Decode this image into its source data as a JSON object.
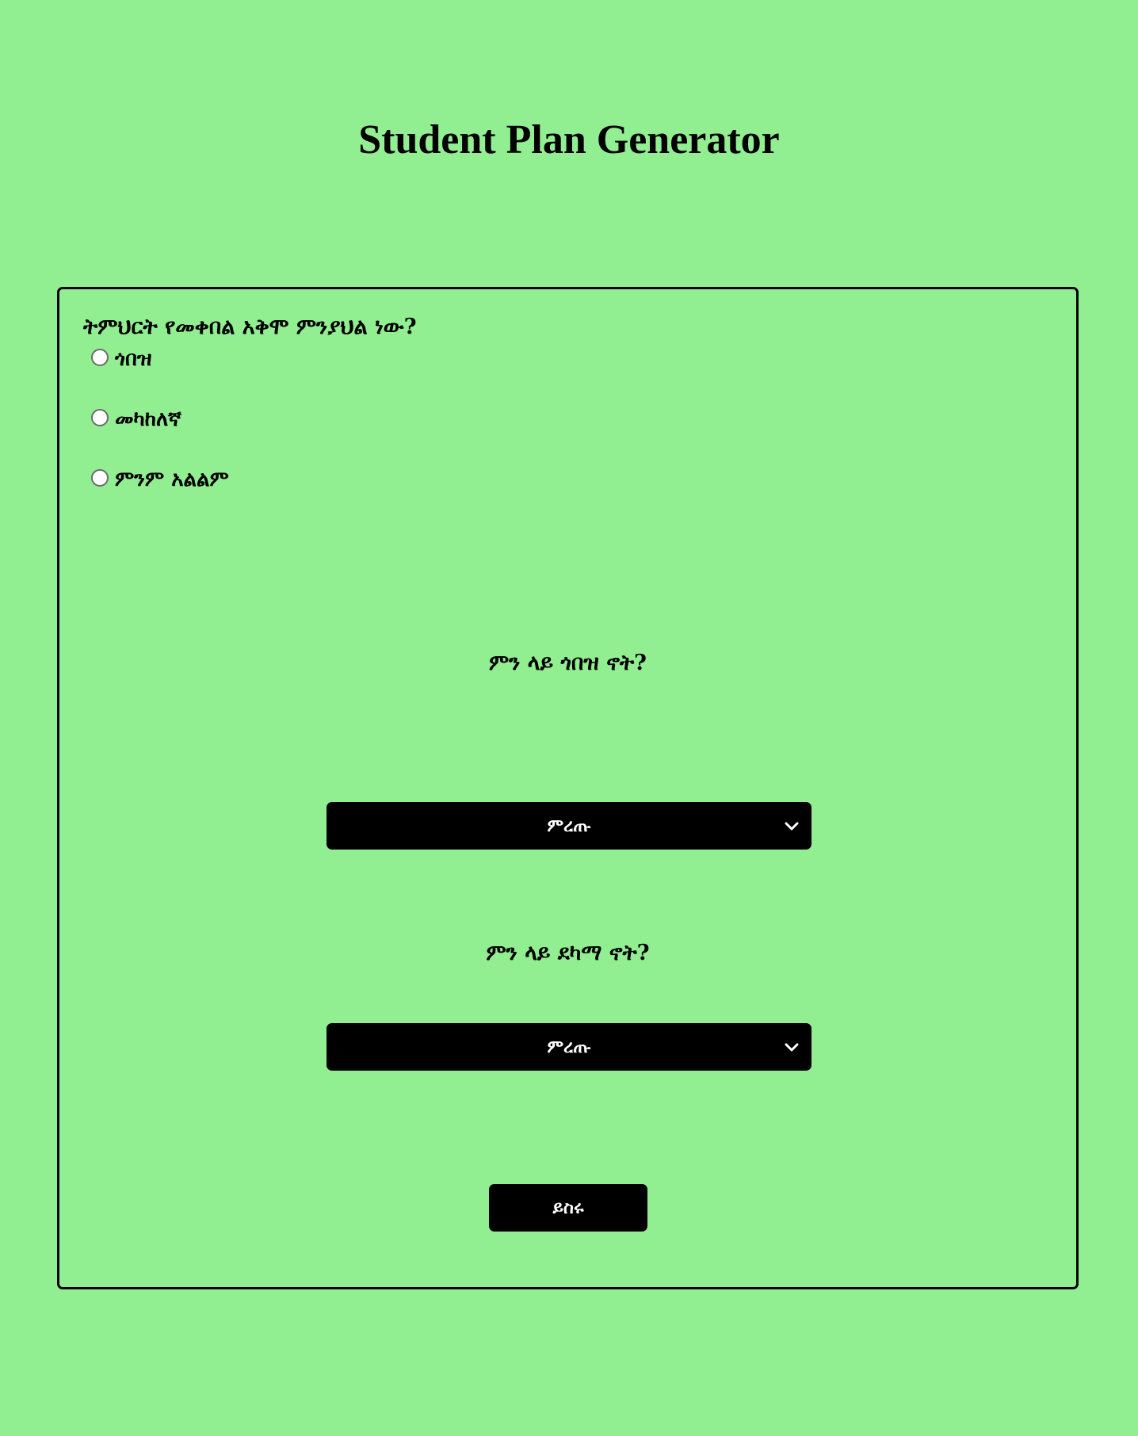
{
  "header": {
    "title": "Student Plan Generator"
  },
  "form": {
    "question_ability": "ትምህርት የመቀበል አቅሞ ምንያህል ነው?",
    "ability_options": [
      {
        "label": "ጎበዝ",
        "checked": false
      },
      {
        "label": "መካከለኛ",
        "checked": false
      },
      {
        "label": "ምንም አልልም",
        "checked": false
      }
    ],
    "question_strong": "ምን ላይ ጎበዝ ኖት?",
    "select_strong": {
      "value": "ምረጡ",
      "icon": "chevron-down-icon"
    },
    "question_weak": "ምን ላይ ደካማ ኖት?",
    "select_weak": {
      "value": "ምረጡ",
      "icon": "chevron-down-icon"
    },
    "submit_label": "ይስሩ"
  },
  "colors": {
    "background": "#92ef91",
    "control_bg": "#000000",
    "control_text": "#ffffff",
    "border": "#000000"
  }
}
